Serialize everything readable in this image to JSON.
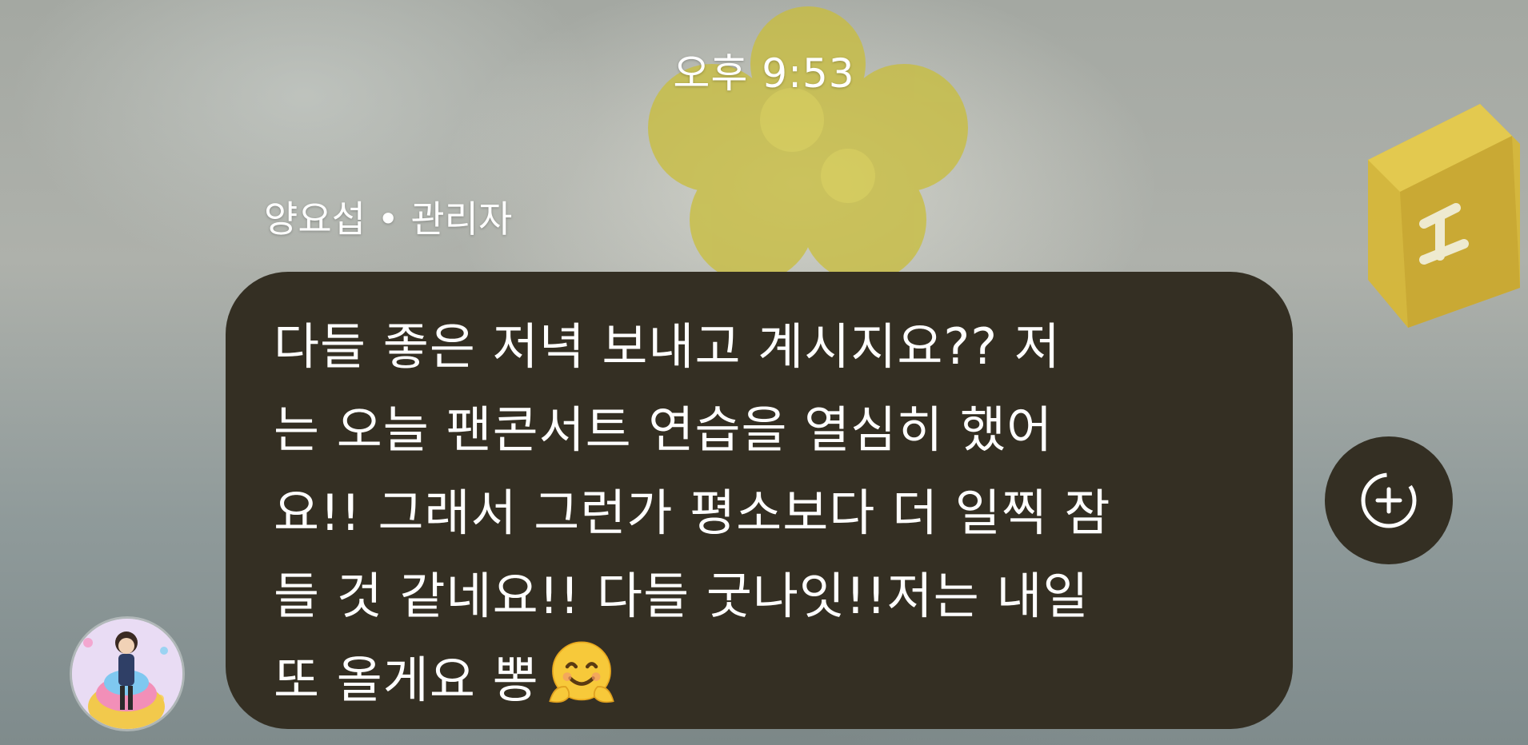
{
  "chat": {
    "timestamp": "오후 9:53",
    "sender_name": "양요섭 • 관리자",
    "message_lines": [
      "다들 좋은 저녁 보내고 계시지요?? 저",
      "는 오늘 팬콘서트 연습을 열심히 했어",
      "요!! 그래서 그런가 평소보다 더 일찍 잠",
      "들 것 같네요!! 다들 굿나잇!!저는 내일",
      "또 올게요 뽕"
    ],
    "emoji": "smiling-face-with-open-hands"
  },
  "icons": {
    "add_reaction": "add-reaction-icon"
  },
  "colors": {
    "bubble": "#342f23",
    "text": "#ffffff",
    "avatar_bg": "#e7d8f2"
  }
}
